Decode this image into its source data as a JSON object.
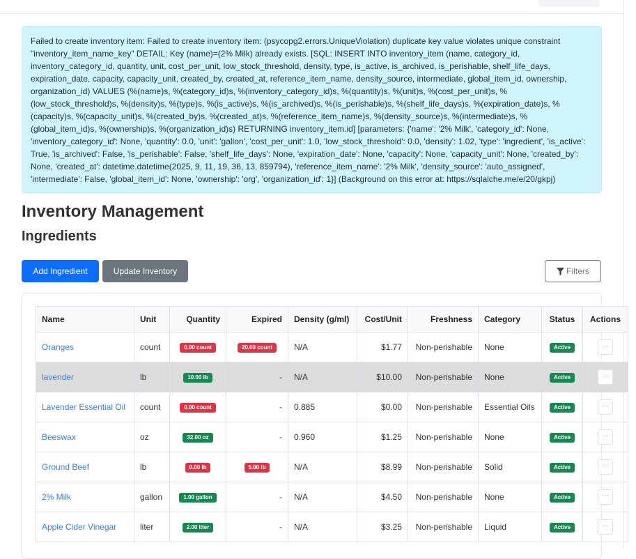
{
  "alert": {
    "message": "Failed to create inventory item: Failed to create inventory item: (psycopg2.errors.UniqueViolation) duplicate key value violates unique constraint \"inventory_item_name_key\" DETAIL: Key (name)=(2% Milk) already exists. [SQL: INSERT INTO inventory_item (name, category_id, inventory_category_id, quantity, unit, cost_per_unit, low_stock_threshold, density, type, is_active, is_archived, is_perishable, shelf_life_days, expiration_date, capacity, capacity_unit, created_by, created_at, reference_item_name, density_source, intermediate, global_item_id, ownership, organization_id) VALUES (%(name)s, %(category_id)s, %(inventory_category_id)s, %(quantity)s, %(unit)s, %(cost_per_unit)s, %(low_stock_threshold)s, %(density)s, %(type)s, %(is_active)s, %(is_archived)s, %(is_perishable)s, %(shelf_life_days)s, %(expiration_date)s, %(capacity)s, %(capacity_unit)s, %(created_by)s, %(created_at)s, %(reference_item_name)s, %(density_source)s, %(intermediate)s, %(global_item_id)s, %(ownership)s, %(organization_id)s) RETURNING inventory_item.id] [parameters: {'name': '2% Milk', 'category_id': None, 'inventory_category_id': None, 'quantity': 0.0, 'unit': 'gallon', 'cost_per_unit': 1.0, 'low_stock_threshold': 0.0, 'density': 1.02, 'type': 'ingredient', 'is_active': True, 'is_archived': False, 'is_perishable': False, 'shelf_life_days': None, 'expiration_date': None, 'capacity': None, 'capacity_unit': None, 'created_by': None, 'created_at': datetime.datetime(2025, 9, 11, 19, 36, 13, 859794), 'reference_item_name': '2% Milk', 'density_source': 'auto_assigned', 'intermediate': False, 'global_item_id': None, 'ownership': 'org', 'organization_id': 1}] (Background on this error at: https://sqlalche.me/e/20/gkpj)"
  },
  "page": {
    "title": "Inventory Management",
    "subtitle": "Ingredients"
  },
  "toolbar": {
    "add_label": "Add Ingredient",
    "update_label": "Update Inventory",
    "filters_label": "Filters"
  },
  "table": {
    "headers": {
      "name": "Name",
      "unit": "Unit",
      "quantity": "Quantity",
      "expired": "Expired",
      "density": "Density (g/ml)",
      "cost": "Cost/Unit",
      "freshness": "Freshness",
      "category": "Category",
      "status": "Status",
      "actions": "Actions"
    },
    "rows": [
      {
        "name": "Oranges",
        "unit": "count",
        "quantity": "0.00 count",
        "quantity_color": "#dc3545",
        "expired": "20.00 count",
        "density": "N/A",
        "cost": "$1.77",
        "freshness": "Non-perishable",
        "category": "None",
        "status": "Active",
        "actions": "···"
      },
      {
        "name": "lavender",
        "unit": "lb",
        "quantity": "10.00 lb",
        "quantity_color": "#198754",
        "expired": "-",
        "density": "N/A",
        "cost": "$10.00",
        "freshness": "Non-perishable",
        "category": "None",
        "status": "Active",
        "actions": "···"
      },
      {
        "name": "Lavender Essential Oil",
        "unit": "count",
        "quantity": "0.00 count",
        "quantity_color": "#dc3545",
        "expired": "-",
        "density": "0.885",
        "cost": "$0.00",
        "freshness": "Non-perishable",
        "category": "Essential Oils",
        "status": "Active",
        "actions": "···"
      },
      {
        "name": "Beeswax",
        "unit": "oz",
        "quantity": "32.00 oz",
        "quantity_color": "#198754",
        "expired": "-",
        "density": "0.960",
        "cost": "$1.25",
        "freshness": "Non-perishable",
        "category": "None",
        "status": "Active",
        "actions": "···"
      },
      {
        "name": "Ground Beef",
        "unit": "lb",
        "quantity": "0.00 lb",
        "quantity_color": "#dc3545",
        "expired": "5.00 lb",
        "density": "N/A",
        "cost": "$8.99",
        "freshness": "Non-perishable",
        "category": "Solid",
        "status": "Active",
        "actions": "···"
      },
      {
        "name": "2% Milk",
        "unit": "gallon",
        "quantity": "1.00 gallon",
        "quantity_color": "#198754",
        "expired": "-",
        "density": "N/A",
        "cost": "$4.50",
        "freshness": "Non-perishable",
        "category": "None",
        "status": "Active",
        "actions": "···"
      },
      {
        "name": "Apple Cider Vinegar",
        "unit": "liter",
        "quantity": "2.00 liter",
        "quantity_color": "#198754",
        "expired": "-",
        "density": "N/A",
        "cost": "$3.25",
        "freshness": "Non-perishable",
        "category": "Liquid",
        "status": "Active",
        "actions": "···"
      }
    ]
  }
}
